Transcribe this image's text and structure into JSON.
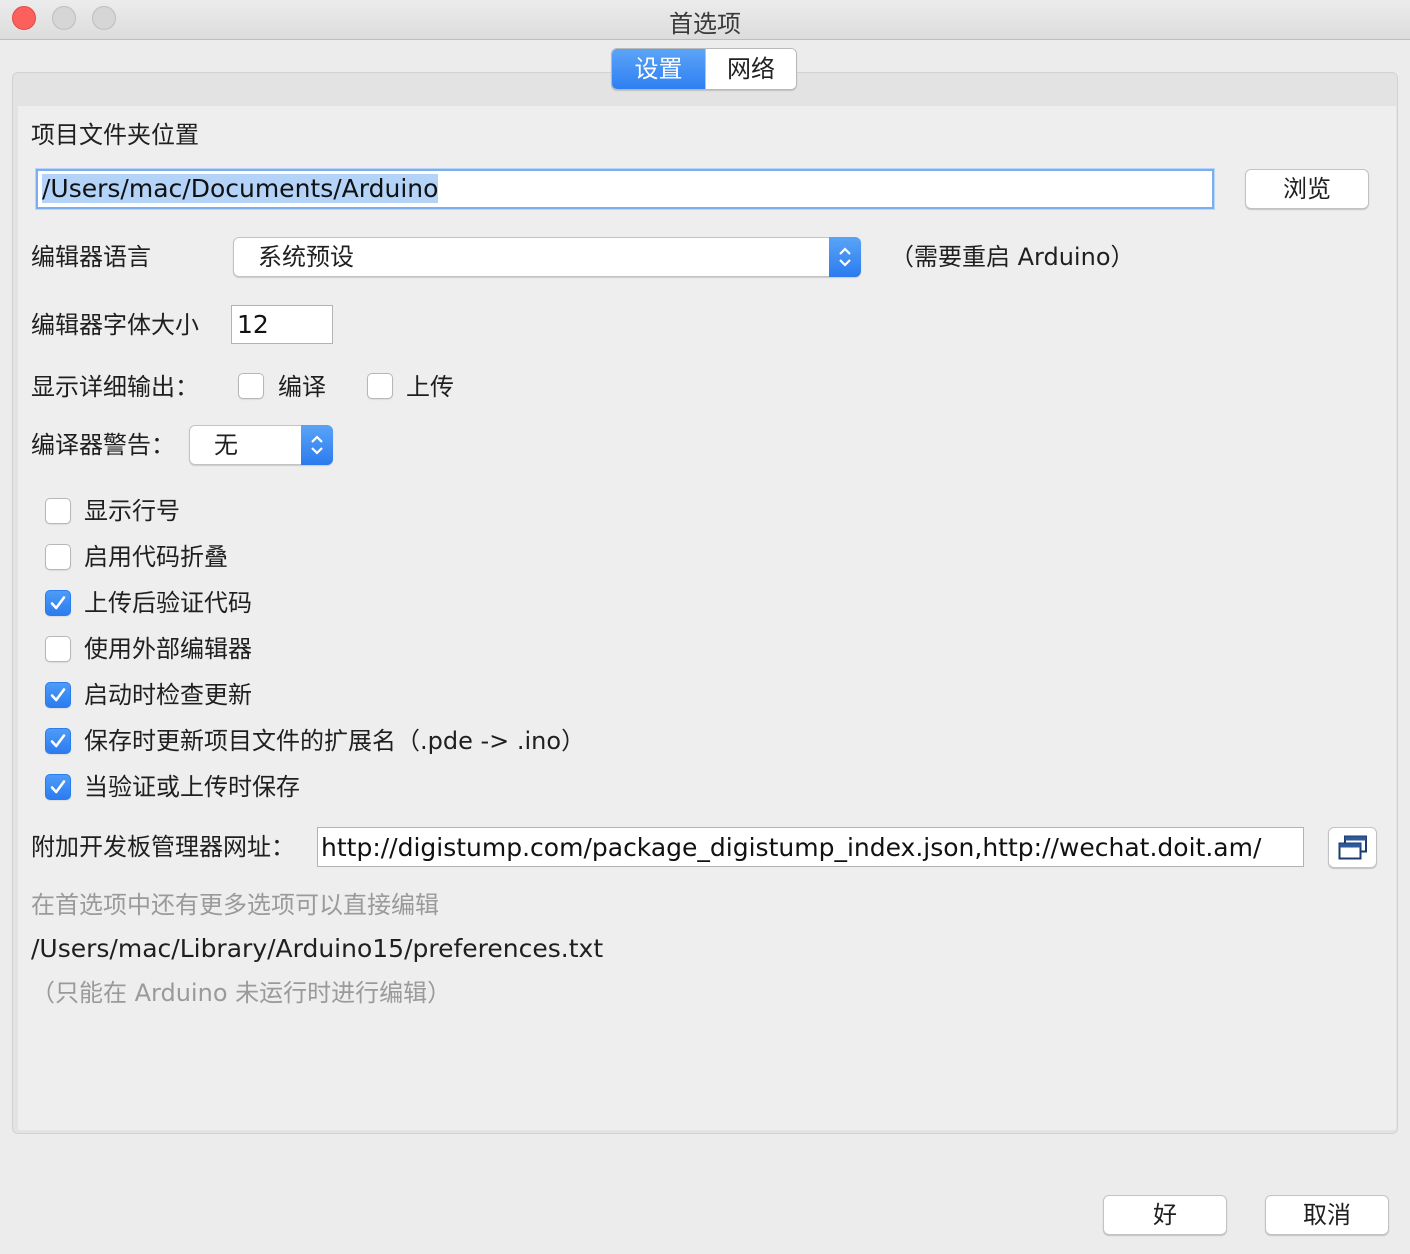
{
  "window": {
    "title": "首选项",
    "traffic_lights": {
      "close": "#fc605c",
      "minimize": "#d6d6d6",
      "zoom": "#d6d6d6"
    }
  },
  "tabs": [
    {
      "label": "设置",
      "active": true
    },
    {
      "label": "网络",
      "active": false
    }
  ],
  "sketchbook": {
    "label": "项目文件夹位置",
    "value": "/Users/mac/Documents/Arduino",
    "browse_label": "浏览"
  },
  "editor_language": {
    "label": "编辑器语言",
    "selected": "系统预设",
    "note": "（需要重启 Arduino）"
  },
  "font_size": {
    "label": "编辑器字体大小",
    "value": "12"
  },
  "verbose_output": {
    "label": "显示详细输出：",
    "compile": {
      "label": "编译",
      "checked": false
    },
    "upload": {
      "label": "上传",
      "checked": false
    }
  },
  "compiler_warnings": {
    "label": "编译器警告：",
    "selected": "无"
  },
  "options": [
    {
      "label": "显示行号",
      "checked": false
    },
    {
      "label": "启用代码折叠",
      "checked": false
    },
    {
      "label": "上传后验证代码",
      "checked": true
    },
    {
      "label": "使用外部编辑器",
      "checked": false
    },
    {
      "label": "启动时检查更新",
      "checked": true
    },
    {
      "label": "保存时更新项目文件的扩展名（.pde -> .ino）",
      "checked": true
    },
    {
      "label": "当验证或上传时保存",
      "checked": true
    }
  ],
  "board_manager": {
    "label": "附加开发板管理器网址：",
    "value": "http://digistump.com/package_digistump_index.json,http://wechat.doit.am/",
    "icon": "window-stack-icon"
  },
  "more_prefs": {
    "hint": "在首选项中还有更多选项可以直接编辑",
    "path": "/Users/mac/Library/Arduino15/preferences.txt",
    "note": "（只能在 Arduino 未运行时进行编辑）"
  },
  "footer": {
    "ok_label": "好",
    "cancel_label": "取消"
  },
  "colors": {
    "accent": "#2f7ff2",
    "checkbox_checked": "#2b7cf0",
    "selection": "#b4d3f8",
    "muted_text": "#9a9a9a"
  }
}
